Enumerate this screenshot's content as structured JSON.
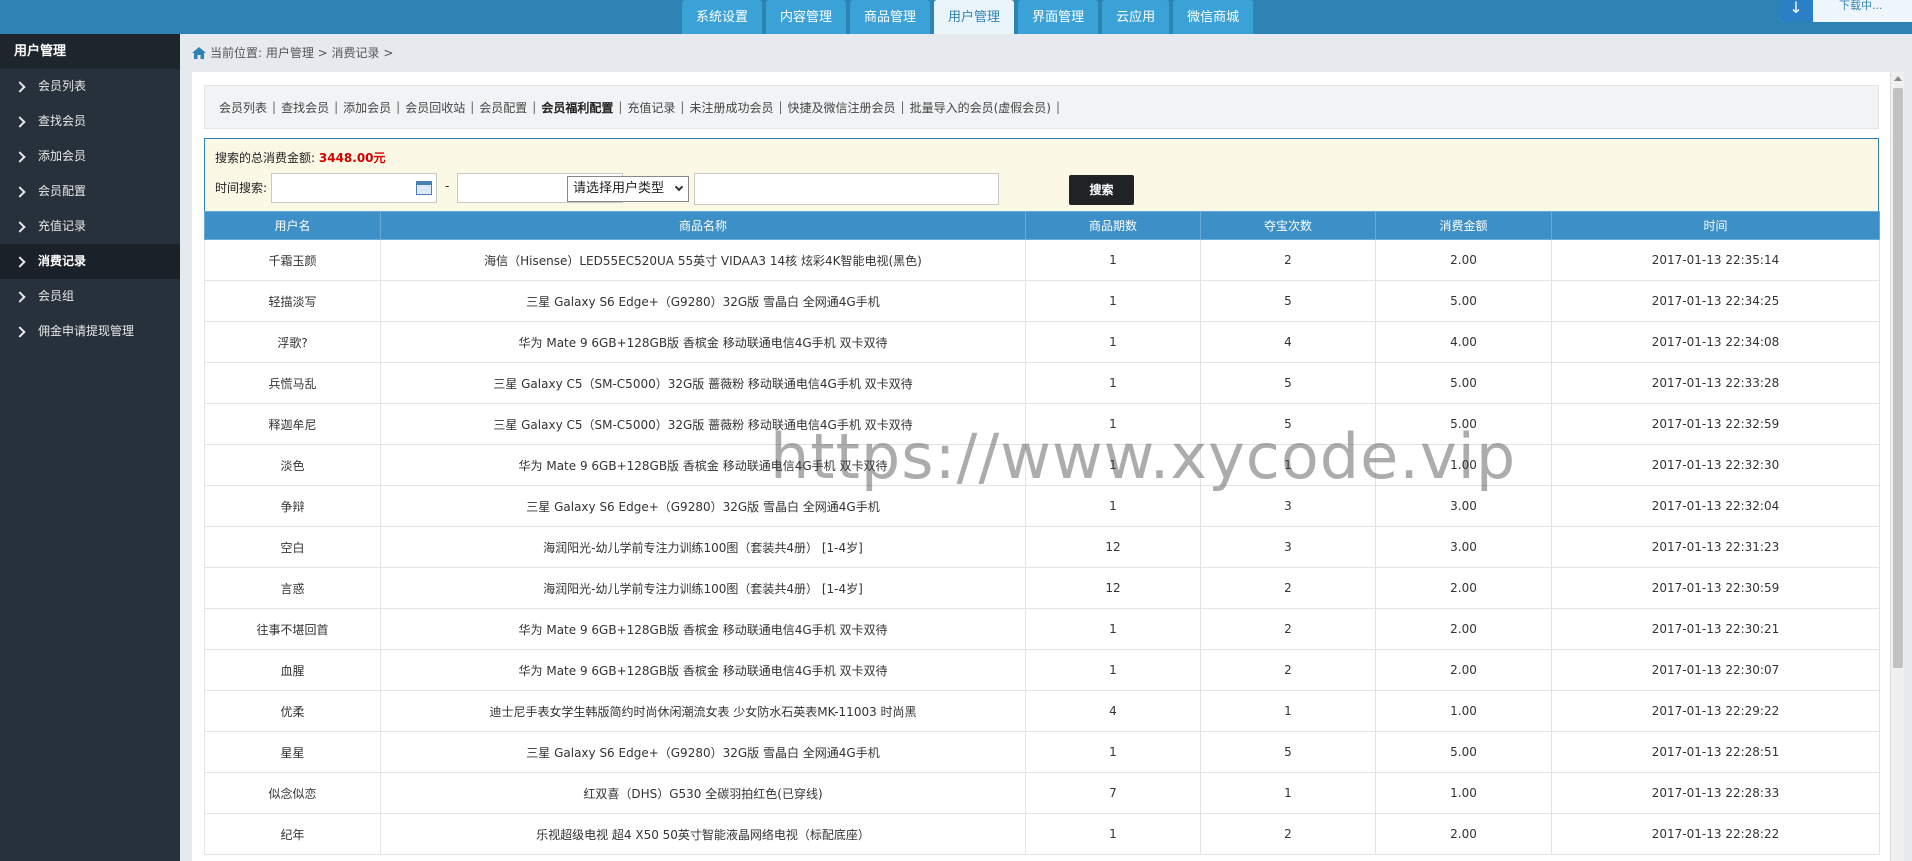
{
  "topnav": {
    "tabs": [
      "系统设置",
      "内容管理",
      "商品管理",
      "用户管理",
      "界面管理",
      "云应用",
      "微信商城"
    ],
    "active_index": 3,
    "download_text": "下载中..."
  },
  "sidebar": {
    "title": "用户管理",
    "items": [
      "会员列表",
      "查找会员",
      "添加会员",
      "会员配置",
      "充值记录",
      "消费记录",
      "会员组",
      "佣金申请提现管理"
    ],
    "active_index": 5
  },
  "breadcrumb": {
    "text": "当前位置: 用户管理 > 消费记录 >"
  },
  "subnav": {
    "links": [
      "会员列表",
      "查找会员",
      "添加会员",
      "会员回收站",
      "会员配置",
      "会员福利配置",
      "充值记录",
      "未注册成功会员",
      "快捷及微信注册会员",
      "批量导入的会员(虚假会员)"
    ],
    "strong_index": 5
  },
  "search": {
    "sum_label": "搜索的总消费金额:",
    "sum_value": "3448.00元",
    "time_label": "时间搜索:",
    "dash": "-",
    "user_type_selected": "请选择用户类型",
    "button_label": "搜索"
  },
  "table": {
    "headers": [
      "用户名",
      "商品名称",
      "商品期数",
      "夺宝次数",
      "消费金额",
      "时间"
    ],
    "rows": [
      [
        "千霜玉颜",
        "海信（Hisense）LED55EC520UA 55英寸 VIDAA3 14核 炫彩4K智能电视(黑色)",
        "1",
        "2",
        "2.00",
        "2017-01-13 22:35:14"
      ],
      [
        "轻描淡写",
        "三星 Galaxy S6 Edge+（G9280）32G版 雪晶白 全网通4G手机",
        "1",
        "5",
        "5.00",
        "2017-01-13 22:34:25"
      ],
      [
        "浮歌?",
        "华为 Mate 9 6GB+128GB版 香槟金 移动联通电信4G手机 双卡双待",
        "1",
        "4",
        "4.00",
        "2017-01-13 22:34:08"
      ],
      [
        "兵慌马乱",
        "三星 Galaxy C5（SM-C5000）32G版 蔷薇粉 移动联通电信4G手机 双卡双待",
        "1",
        "5",
        "5.00",
        "2017-01-13 22:33:28"
      ],
      [
        "释迦牟尼",
        "三星 Galaxy C5（SM-C5000）32G版 蔷薇粉 移动联通电信4G手机 双卡双待",
        "1",
        "5",
        "5.00",
        "2017-01-13 22:32:59"
      ],
      [
        "淡色",
        "华为 Mate 9 6GB+128GB版 香槟金 移动联通电信4G手机 双卡双待",
        "1",
        "1",
        "1.00",
        "2017-01-13 22:32:30"
      ],
      [
        "争辩",
        "三星 Galaxy S6 Edge+（G9280）32G版 雪晶白 全网通4G手机",
        "1",
        "3",
        "3.00",
        "2017-01-13 22:32:04"
      ],
      [
        "空白",
        "海润阳光-幼儿学前专注力训练100图（套装共4册） [1-4岁]",
        "12",
        "3",
        "3.00",
        "2017-01-13 22:31:23"
      ],
      [
        "言惑",
        "海润阳光-幼儿学前专注力训练100图（套装共4册） [1-4岁]",
        "12",
        "2",
        "2.00",
        "2017-01-13 22:30:59"
      ],
      [
        "往事不堪回首",
        "华为 Mate 9 6GB+128GB版 香槟金 移动联通电信4G手机 双卡双待",
        "1",
        "2",
        "2.00",
        "2017-01-13 22:30:21"
      ],
      [
        "血腥",
        "华为 Mate 9 6GB+128GB版 香槟金 移动联通电信4G手机 双卡双待",
        "1",
        "2",
        "2.00",
        "2017-01-13 22:30:07"
      ],
      [
        "优柔",
        "迪士尼手表女学生韩版简约时尚休闲潮流女表 少女防水石英表MK-11003 时尚黑",
        "4",
        "1",
        "1.00",
        "2017-01-13 22:29:22"
      ],
      [
        "星星",
        "三星 Galaxy S6 Edge+（G9280）32G版 雪晶白 全网通4G手机",
        "1",
        "5",
        "5.00",
        "2017-01-13 22:28:51"
      ],
      [
        "似念似恋",
        "红双喜（DHS）G530 全碳羽拍红色(已穿线)",
        "7",
        "1",
        "1.00",
        "2017-01-13 22:28:33"
      ],
      [
        "纪年",
        "乐视超级电视 超4 X50 50英寸智能液晶网络电视（标配底座）",
        "1",
        "2",
        "2.00",
        "2017-01-13 22:28:22"
      ]
    ]
  },
  "watermark": "https://www.xycode.vip"
}
